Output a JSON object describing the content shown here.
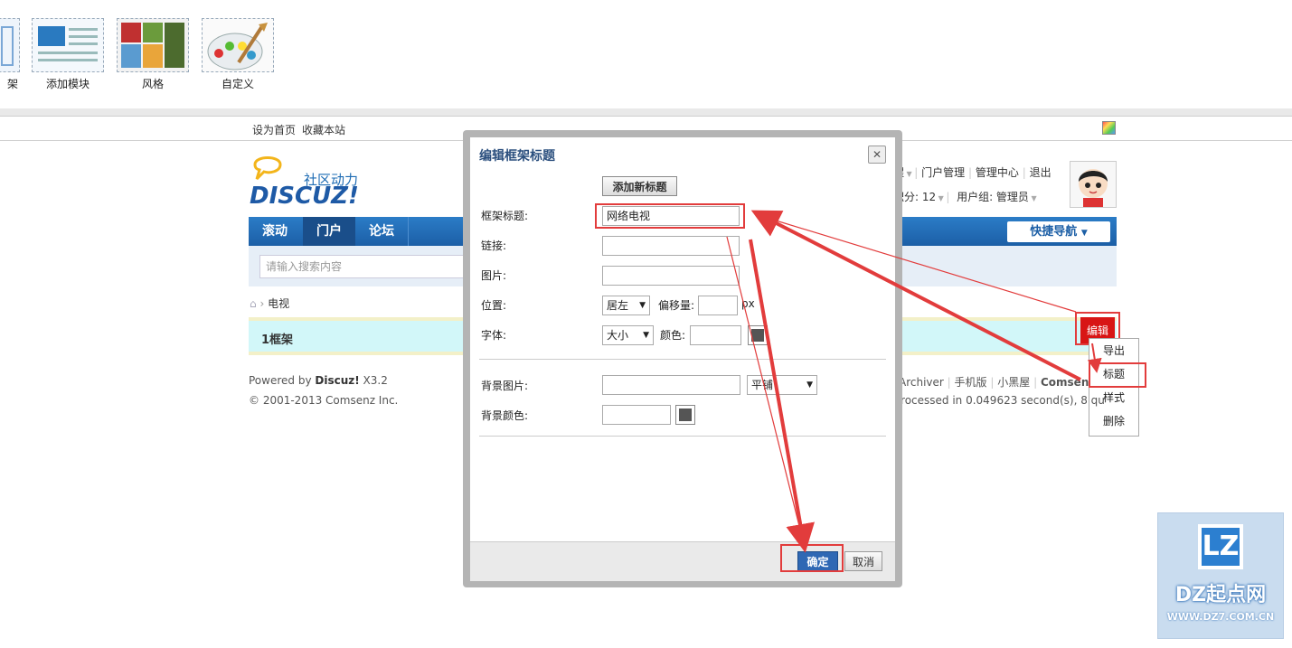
{
  "toolbar": {
    "items": [
      {
        "label": "架"
      },
      {
        "label": "添加模块"
      },
      {
        "label": "风格"
      },
      {
        "label": "自定义"
      }
    ]
  },
  "topnav": {
    "set_home": "设为首页",
    "bookmark": "收藏本站"
  },
  "logo": {
    "tagline": "社区动力",
    "brand": "DISCUZ!"
  },
  "user_bar": {
    "remind": "醒",
    "portal_admin": "门户管理",
    "admin_center": "管理中心",
    "logout": "退出",
    "points": "积分: 12",
    "user_group": "用户组: 管理员"
  },
  "nav": {
    "items": [
      "滚动",
      "门户",
      "论坛"
    ],
    "active": "门户",
    "quick_nav": "快捷导航"
  },
  "search": {
    "placeholder": "请输入搜索内容"
  },
  "breadcrumb": {
    "current": "电视"
  },
  "frame": {
    "title": "1框架",
    "edit_button": "编辑"
  },
  "edit_menu": {
    "items": [
      "导出",
      "标题",
      "样式",
      "删除"
    ]
  },
  "footer": {
    "powered_prefix": "Powered by ",
    "powered_brand": "Discuz!",
    "powered_version": " X3.2",
    "copyright": "© 2001-2013 Comsenz Inc.",
    "links": [
      "Archiver",
      "手机版",
      "小黑屋",
      "Comsen"
    ],
    "processed": "Processed in 0.049623 second(s), 8 qu"
  },
  "dialog": {
    "title": "编辑框架标题",
    "add_title_button": "添加新标题",
    "fields": {
      "frame_title_label": "框架标题:",
      "frame_title_value": "网络电视",
      "link_label": "链接:",
      "image_label": "图片:",
      "position_label": "位置:",
      "position_value": "居左",
      "offset_label": "偏移量:",
      "offset_unit": "px",
      "font_label": "字体:",
      "font_value": "大小",
      "color_label": "颜色:",
      "bg_image_label": "背景图片:",
      "bg_repeat_value": "平铺",
      "bg_color_label": "背景颜色:"
    },
    "confirm_button": "确定",
    "cancel_button": "取消"
  },
  "watermark": {
    "logo_text": "LZ",
    "name": "DZ起点网",
    "url": "WWW.DZ7.COM.CN"
  },
  "colors": {
    "annotation": "#e23c3c",
    "nav_blue": "#1c5fa6",
    "frame_bg": "#d2f7f9"
  }
}
